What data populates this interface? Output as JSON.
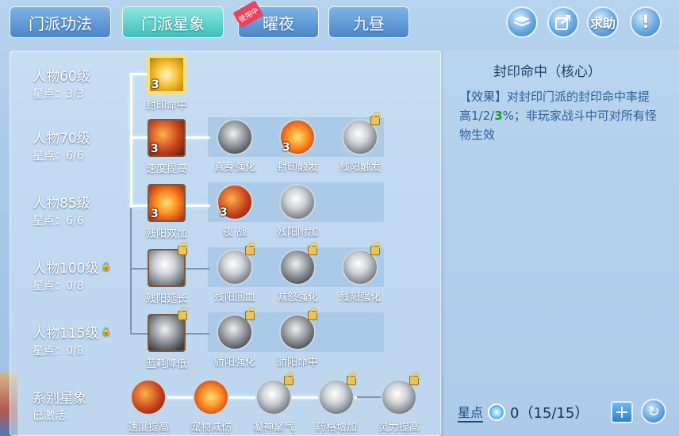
{
  "tabs": [
    {
      "label": "门派功法",
      "active": false
    },
    {
      "label": "门派星象",
      "active": true
    },
    {
      "label": "曜夜",
      "active": false,
      "badge": "使用中"
    },
    {
      "label": "九昼",
      "active": false
    }
  ],
  "top_buttons": [
    {
      "icon": "book-icon"
    },
    {
      "icon": "share-icon"
    },
    {
      "label": "求助"
    },
    {
      "label": "!"
    }
  ],
  "levels": [
    {
      "title": "人物60级",
      "stars": "星点：3/3",
      "locked": false
    },
    {
      "title": "人物70级",
      "stars": "星点：6/6",
      "locked": false
    },
    {
      "title": "人物85级",
      "stars": "星点：6/6",
      "locked": false
    },
    {
      "title": "人物100级",
      "stars": "星点：0/8",
      "locked": true
    },
    {
      "title": "人物115级",
      "stars": "星点：0/8",
      "locked": true
    },
    {
      "title": "系别星象",
      "stars": "已激活",
      "locked": false
    }
  ],
  "skills": {
    "r1": [
      {
        "name": "封印命中",
        "level": "3",
        "style": "gold"
      }
    ],
    "r2": [
      {
        "name": "速度提高",
        "level": "3",
        "style": "fire-dark"
      },
      {
        "name": "真身强化",
        "level": "",
        "style": "grey-dark"
      },
      {
        "name": "封印触发",
        "level": "3",
        "style": "fire"
      },
      {
        "name": "残阳触发",
        "level": "",
        "style": "grey",
        "locked": true
      }
    ],
    "r3": [
      {
        "name": "残阳双加",
        "level": "3",
        "style": "fire"
      },
      {
        "name": "夜 战",
        "level": "3",
        "style": "fire-dark"
      },
      {
        "name": "残阳附加",
        "level": "",
        "style": "grey"
      }
    ],
    "r4": [
      {
        "name": "残阳延长",
        "level": "",
        "style": "grey",
        "locked": true
      },
      {
        "name": "残阳回血",
        "level": "",
        "style": "grey",
        "locked": true
      },
      {
        "name": "减怒强化",
        "level": "",
        "style": "grey-dark",
        "locked": true
      },
      {
        "name": "残阳强化",
        "level": "",
        "style": "grey",
        "locked": true
      }
    ],
    "r5": [
      {
        "name": "蓝耗降低",
        "level": "",
        "style": "grey-dark",
        "locked": true
      },
      {
        "name": "骄阳强化",
        "level": "",
        "style": "grey-dark",
        "locked": true
      },
      {
        "name": "骄阳命中",
        "level": "",
        "style": "grey-dark",
        "locked": true
      }
    ],
    "r6": [
      {
        "name": "速度提高",
        "style": "fire-dark"
      },
      {
        "name": "宠物减伤",
        "style": "fire"
      },
      {
        "name": "凝神聚气",
        "style": "grey",
        "locked": true
      },
      {
        "name": "药格增加",
        "style": "grey",
        "locked": true
      },
      {
        "name": "灵力提高",
        "style": "grey",
        "locked": true
      }
    ]
  },
  "detail": {
    "title": "封印命中（核心）",
    "desc_a": "【效果】对封印门派的封印命中率提高1/2/",
    "desc_hl": "3",
    "desc_b": "%；非玩家战斗中可对所有怪物生效"
  },
  "star_bar": {
    "label": "星点",
    "value": "0（15/15）"
  }
}
